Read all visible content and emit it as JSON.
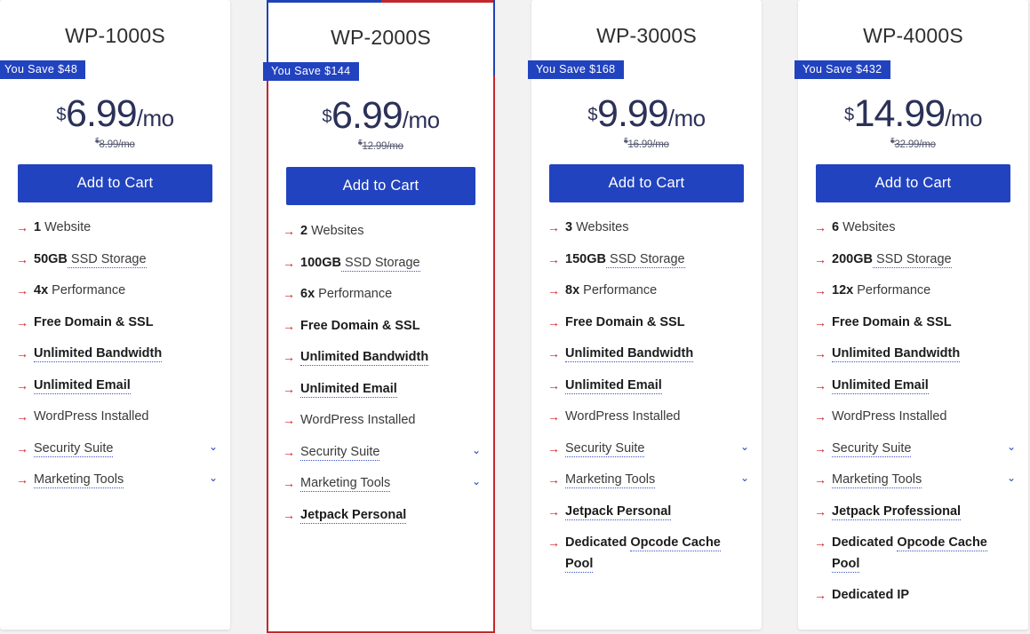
{
  "colors": {
    "brand_blue": "#2243bf",
    "accent_red": "#c1272d",
    "arrow_red": "#cf2026",
    "price_navy": "#2b3157",
    "page_bg": "#f2f2f2"
  },
  "icons": {
    "arrow": "→",
    "chevron_down": "⌄"
  },
  "plans": [
    {
      "name": "WP-1000S",
      "save_badge": "You Save $48",
      "currency": "$",
      "price": "6.99",
      "period": "/mo",
      "old_currency": "$",
      "old_price": "8.99/mo",
      "cta": "Add to Cart",
      "featured": false,
      "features": [
        {
          "strong": "1",
          "rest": " Website",
          "dotted": false,
          "chevron": false,
          "bold": false
        },
        {
          "strong": "50GB",
          "rest": " SSD Storage",
          "dotted": true,
          "chevron": false,
          "bold": false
        },
        {
          "strong": "4x",
          "rest": " Performance",
          "dotted": false,
          "chevron": false,
          "bold": false
        },
        {
          "strong": "",
          "rest": "Free Domain & SSL",
          "dotted": false,
          "chevron": false,
          "bold": true
        },
        {
          "strong": "",
          "rest": "Unlimited Bandwidth",
          "dotted": true,
          "chevron": false,
          "bold": true
        },
        {
          "strong": "",
          "rest": "Unlimited Email",
          "dotted": true,
          "chevron": false,
          "bold": true
        },
        {
          "strong": "",
          "rest": "WordPress Installed",
          "dotted": false,
          "chevron": false,
          "bold": false
        },
        {
          "strong": "",
          "rest": "Security Suite",
          "dotted": true,
          "chevron": true,
          "bold": false
        },
        {
          "strong": "",
          "rest": "Marketing Tools",
          "dotted": true,
          "chevron": true,
          "bold": false
        }
      ]
    },
    {
      "name": "WP-2000S",
      "save_badge": "You Save $144",
      "currency": "$",
      "price": "6.99",
      "period": "/mo",
      "old_currency": "$",
      "old_price": "12.99/mo",
      "cta": "Add to Cart",
      "featured": true,
      "features": [
        {
          "strong": "2",
          "rest": " Websites",
          "dotted": false,
          "chevron": false,
          "bold": false
        },
        {
          "strong": "100GB",
          "rest": " SSD Storage",
          "dotted": true,
          "chevron": false,
          "bold": false
        },
        {
          "strong": "6x",
          "rest": " Performance",
          "dotted": false,
          "chevron": false,
          "bold": false
        },
        {
          "strong": "",
          "rest": "Free Domain & SSL",
          "dotted": false,
          "chevron": false,
          "bold": true
        },
        {
          "strong": "",
          "rest": "Unlimited Bandwidth",
          "dotted": true,
          "chevron": false,
          "bold": true
        },
        {
          "strong": "",
          "rest": "Unlimited Email",
          "dotted": true,
          "chevron": false,
          "bold": true
        },
        {
          "strong": "",
          "rest": "WordPress Installed",
          "dotted": false,
          "chevron": false,
          "bold": false
        },
        {
          "strong": "",
          "rest": "Security Suite",
          "dotted": true,
          "chevron": true,
          "bold": false
        },
        {
          "strong": "",
          "rest": "Marketing Tools",
          "dotted": true,
          "chevron": true,
          "bold": false
        },
        {
          "strong": "",
          "rest": "Jetpack Personal",
          "dotted": true,
          "chevron": false,
          "bold": true
        }
      ]
    },
    {
      "name": "WP-3000S",
      "save_badge": "You Save $168",
      "currency": "$",
      "price": "9.99",
      "period": "/mo",
      "old_currency": "$",
      "old_price": "16.99/mo",
      "cta": "Add to Cart",
      "featured": false,
      "features": [
        {
          "strong": "3",
          "rest": " Websites",
          "dotted": false,
          "chevron": false,
          "bold": false
        },
        {
          "strong": "150GB",
          "rest": " SSD Storage",
          "dotted": true,
          "chevron": false,
          "bold": false
        },
        {
          "strong": "8x",
          "rest": " Performance",
          "dotted": false,
          "chevron": false,
          "bold": false
        },
        {
          "strong": "",
          "rest": "Free Domain & SSL",
          "dotted": false,
          "chevron": false,
          "bold": true
        },
        {
          "strong": "",
          "rest": "Unlimited Bandwidth",
          "dotted": true,
          "chevron": false,
          "bold": true
        },
        {
          "strong": "",
          "rest": "Unlimited Email",
          "dotted": true,
          "chevron": false,
          "bold": true
        },
        {
          "strong": "",
          "rest": "WordPress Installed",
          "dotted": false,
          "chevron": false,
          "bold": false
        },
        {
          "strong": "",
          "rest": "Security Suite",
          "dotted": true,
          "chevron": true,
          "bold": false
        },
        {
          "strong": "",
          "rest": "Marketing Tools",
          "dotted": true,
          "chevron": true,
          "bold": false
        },
        {
          "strong": "",
          "rest": "Jetpack Personal",
          "dotted": true,
          "chevron": false,
          "bold": true
        },
        {
          "strong": "Dedicated ",
          "rest": "Opcode Cache Pool",
          "dotted": true,
          "chevron": false,
          "bold": true
        }
      ]
    },
    {
      "name": "WP-4000S",
      "save_badge": "You Save $432",
      "currency": "$",
      "price": "14.99",
      "period": "/mo",
      "old_currency": "$",
      "old_price": "32.99/mo",
      "cta": "Add to Cart",
      "featured": false,
      "features": [
        {
          "strong": "6",
          "rest": " Websites",
          "dotted": false,
          "chevron": false,
          "bold": false
        },
        {
          "strong": "200GB",
          "rest": " SSD Storage",
          "dotted": true,
          "chevron": false,
          "bold": false
        },
        {
          "strong": "12x",
          "rest": " Performance",
          "dotted": false,
          "chevron": false,
          "bold": false
        },
        {
          "strong": "",
          "rest": "Free Domain & SSL",
          "dotted": false,
          "chevron": false,
          "bold": true
        },
        {
          "strong": "",
          "rest": "Unlimited Bandwidth",
          "dotted": true,
          "chevron": false,
          "bold": true
        },
        {
          "strong": "",
          "rest": "Unlimited Email",
          "dotted": true,
          "chevron": false,
          "bold": true
        },
        {
          "strong": "",
          "rest": "WordPress Installed",
          "dotted": false,
          "chevron": false,
          "bold": false
        },
        {
          "strong": "",
          "rest": "Security Suite",
          "dotted": true,
          "chevron": true,
          "bold": false
        },
        {
          "strong": "",
          "rest": "Marketing Tools",
          "dotted": true,
          "chevron": true,
          "bold": false
        },
        {
          "strong": "",
          "rest": "Jetpack Professional",
          "dotted": true,
          "chevron": false,
          "bold": true
        },
        {
          "strong": "Dedicated ",
          "rest": "Opcode Cache Pool",
          "dotted": true,
          "chevron": false,
          "bold": true
        },
        {
          "strong": "",
          "rest": "Dedicated IP",
          "dotted": false,
          "chevron": false,
          "bold": true
        }
      ]
    }
  ]
}
